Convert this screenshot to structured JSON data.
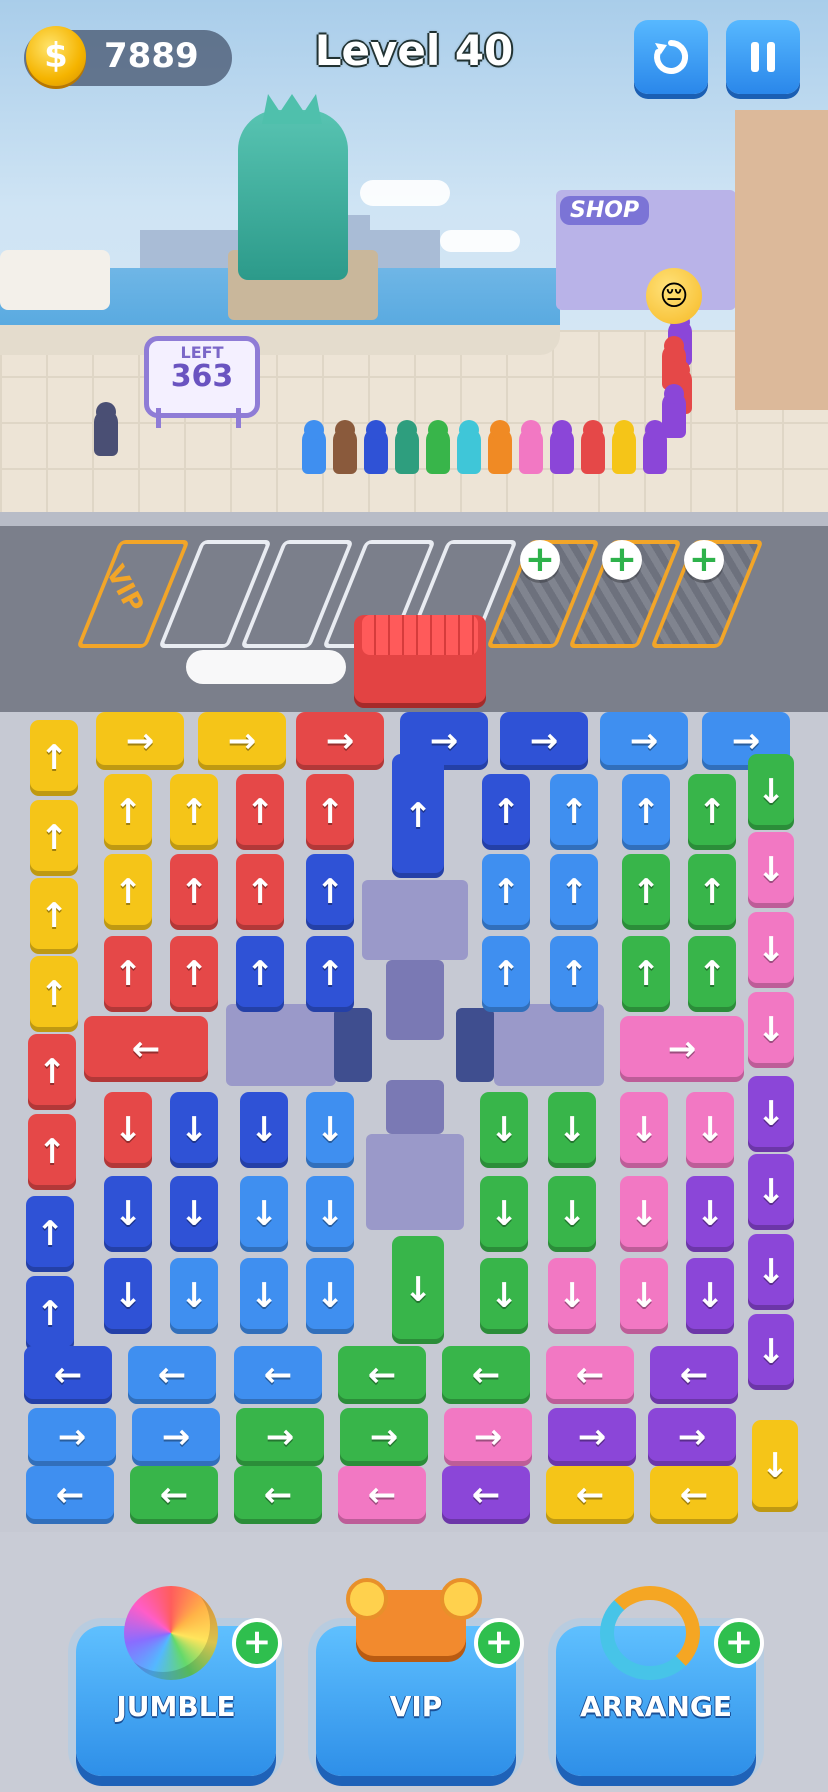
{
  "hud": {
    "coin_symbol": "$",
    "coins": "7889",
    "level": "Level 40",
    "restart_icon": "restart-icon",
    "pause_icon": "pause-icon"
  },
  "scene": {
    "left_label": "LEFT",
    "left_value": "363",
    "shop_sign": "SHOP"
  },
  "parking": {
    "vip_label": "VIP"
  },
  "arrows": {
    "up": "↑",
    "down": "↓",
    "left": "←",
    "right": "→"
  },
  "colors": {
    "yellow": "#f5c518",
    "red": "#e54848",
    "blue": "#2f52d6",
    "lightblue": "#3f8ff0",
    "green": "#38b54a",
    "pink": "#f278c3",
    "purple": "#8b46d8"
  },
  "boosters": [
    {
      "label": "JUMBLE",
      "icon": "color-ball-icon"
    },
    {
      "label": "VIP",
      "icon": "flying-car-icon"
    },
    {
      "label": "ARRANGE",
      "icon": "arrange-arrows-icon"
    }
  ]
}
